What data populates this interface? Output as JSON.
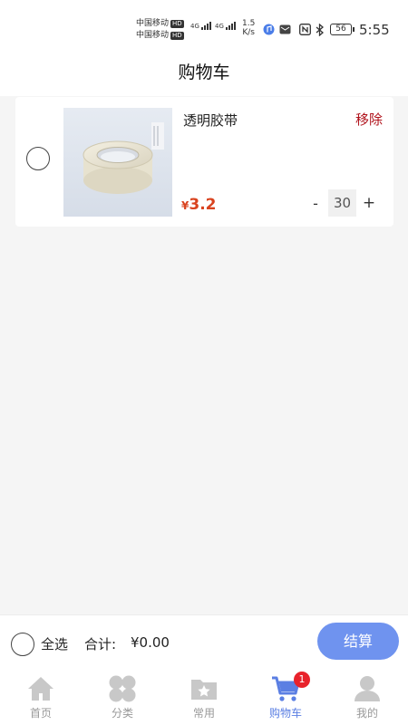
{
  "status_bar": {
    "carrier_1": "中国移动",
    "carrier_2": "中国移动",
    "hd_badge": "HD",
    "network_1": "4G",
    "network_2": "4G",
    "speed_value": "1.5",
    "speed_unit": "K/s",
    "battery": "56",
    "time": "5:55"
  },
  "header": {
    "title": "购物车"
  },
  "cart": {
    "items": [
      {
        "name": "透明胶带",
        "remove_label": "移除",
        "currency": "¥",
        "price": "3.2",
        "quantity": "30",
        "minus_label": "-",
        "plus_label": "+",
        "selected": false
      }
    ]
  },
  "footer": {
    "select_all_label": "全选",
    "total_label": "合计:",
    "total_value": "¥0.00",
    "checkout_label": "结算"
  },
  "tabs": [
    {
      "label": "首页",
      "icon": "home-icon"
    },
    {
      "label": "分类",
      "icon": "category-icon"
    },
    {
      "label": "常用",
      "icon": "favorites-folder-icon"
    },
    {
      "label": "购物车",
      "icon": "shopping-cart-icon",
      "active": true,
      "badge": "1"
    },
    {
      "label": "我的",
      "icon": "profile-icon"
    }
  ],
  "colors": {
    "accent": "#5b7fe3",
    "checkout": "#6f93ef",
    "price": "#d9431f",
    "remove": "#b0121b",
    "badge": "#e8222b",
    "inactive_tab": "#c8c8c8"
  }
}
